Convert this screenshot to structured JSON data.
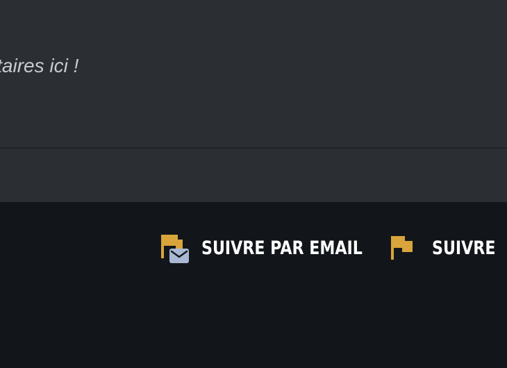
{
  "comments": {
    "hint_text": "entaires ici !"
  },
  "footer": {
    "actions": [
      {
        "label": "SUIVRE PAR EMAIL",
        "icon": "flag-mail-icon"
      },
      {
        "label": "SUIVRE",
        "icon": "flag-icon"
      }
    ]
  },
  "colors": {
    "panel_background": "#2b2f33",
    "footer_background": "#12161a",
    "accent_flag": "#d9a43b",
    "mail_badge": "#a9b8d4",
    "text": "#ffffff"
  }
}
